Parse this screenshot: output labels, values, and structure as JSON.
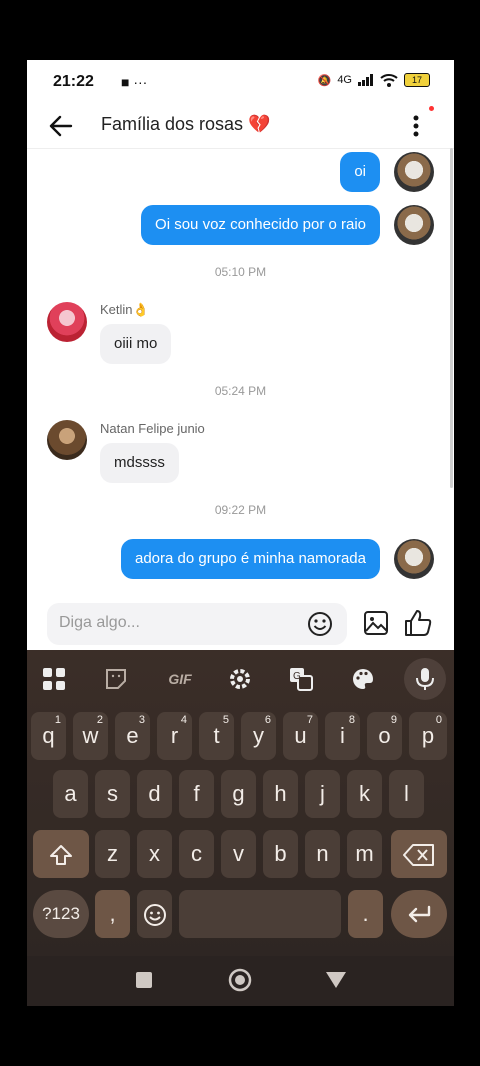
{
  "status_bar": {
    "time": "21:22",
    "icons": "■ ···",
    "network": "4G",
    "battery": "17"
  },
  "header": {
    "title": "Família dos rosas 💔",
    "back_icon": "arrow-left-icon",
    "menu_icon": "more-vertical-icon"
  },
  "messages": [
    {
      "type": "out",
      "text": "oi"
    },
    {
      "type": "out",
      "text": "Oi sou voz conhecido por o raio"
    },
    {
      "type": "timestamp",
      "text": "05:10 PM"
    },
    {
      "type": "in",
      "sender": "Ketlin👌",
      "text": "oiii mo"
    },
    {
      "type": "timestamp",
      "text": "05:24 PM"
    },
    {
      "type": "in",
      "sender": "Natan Felipe junio",
      "text": "mdssss"
    },
    {
      "type": "timestamp",
      "text": "09:22 PM"
    },
    {
      "type": "out",
      "text": "adora do grupo é minha namorada"
    }
  ],
  "input": {
    "placeholder": "Diga algo..."
  },
  "keyboard": {
    "toolbar": [
      "apps-icon",
      "sticker-icon",
      "GIF",
      "settings-icon",
      "translate-icon",
      "palette-icon",
      "mic-icon"
    ],
    "row1": [
      "q",
      "w",
      "e",
      "r",
      "t",
      "y",
      "u",
      "i",
      "o",
      "p"
    ],
    "row1_nums": [
      "1",
      "2",
      "3",
      "4",
      "5",
      "6",
      "7",
      "8",
      "9",
      "0"
    ],
    "row2": [
      "a",
      "s",
      "d",
      "f",
      "g",
      "h",
      "j",
      "k",
      "l"
    ],
    "row3": [
      "z",
      "x",
      "c",
      "v",
      "b",
      "n",
      "m"
    ],
    "row4": {
      "sym": "?123",
      "comma": ",",
      "period": "."
    }
  },
  "colors": {
    "accent": "#1d8ff2",
    "keyboard_bg": "#3b2e28"
  }
}
